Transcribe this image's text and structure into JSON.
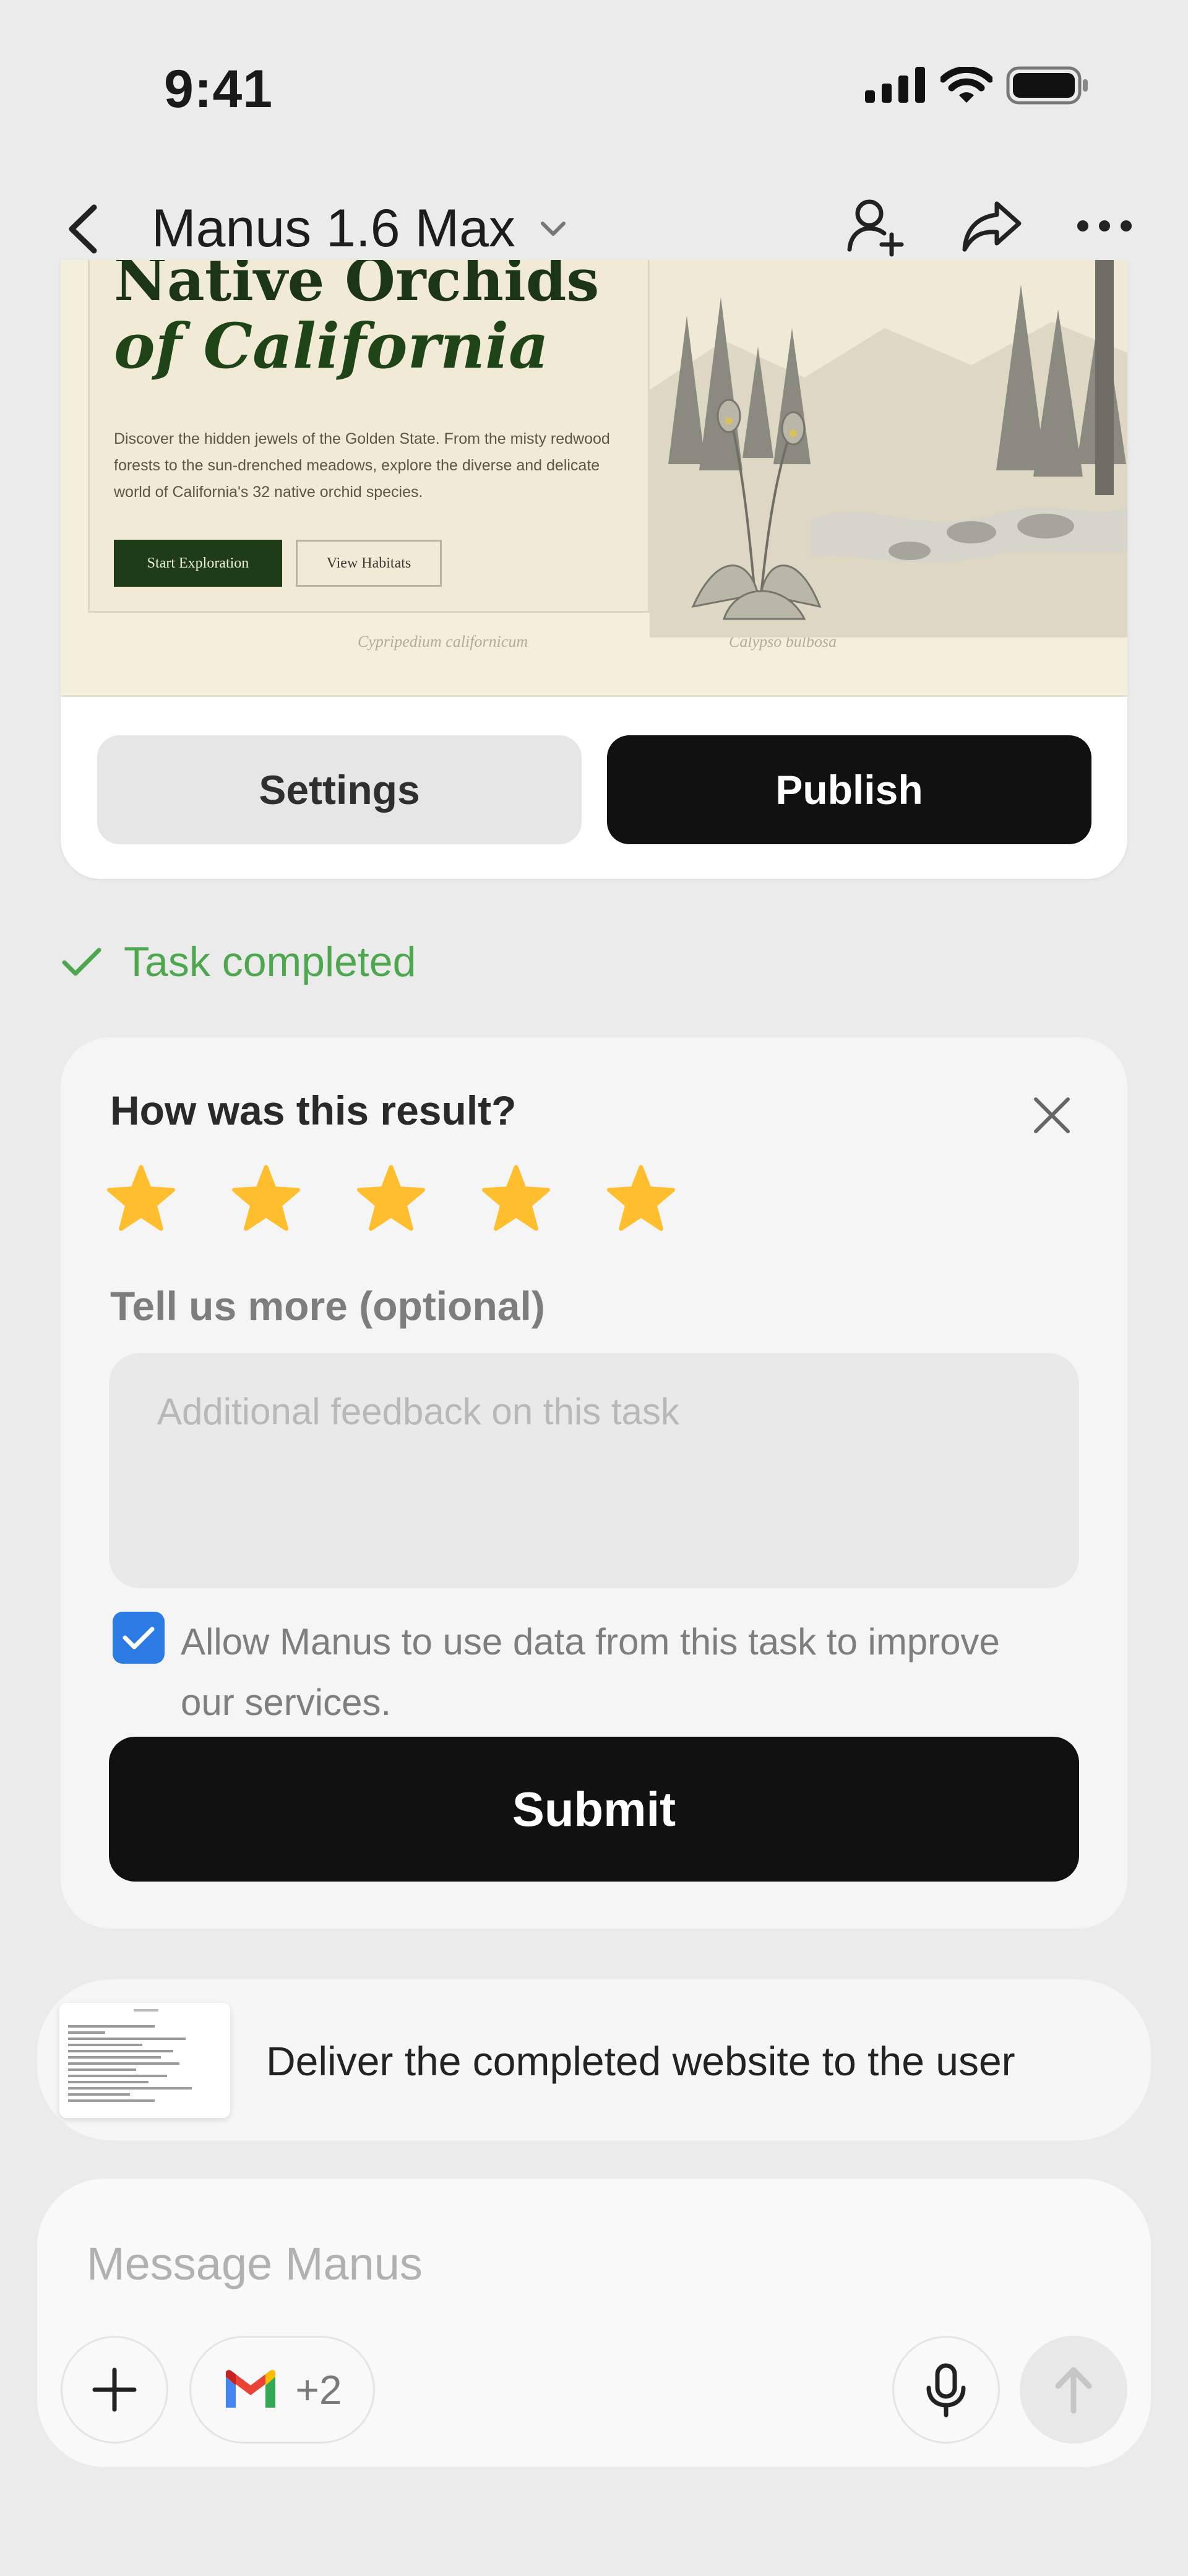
{
  "status_bar": {
    "time": "9:41"
  },
  "header": {
    "title": "Manus 1.6 Max"
  },
  "preview": {
    "hero_title_line1": "Native Orchids",
    "hero_title_line2": "of California",
    "hero_description": "Discover the hidden jewels of the Golden State. From the misty redwood forests to the sun-drenched meadows, explore the diverse and delicate world of California's 32 native orchid species.",
    "primary_button": "Start Exploration",
    "secondary_button": "View Habitats",
    "caption_left": "Cypripedium californicum",
    "caption_right": "Calypso bulbosa"
  },
  "card_actions": {
    "settings_label": "Settings",
    "publish_label": "Publish"
  },
  "task_status": "Task completed",
  "feedback": {
    "title": "How was this result?",
    "rating": 5,
    "rating_max": 5,
    "more_label": "Tell us more (optional)",
    "input_placeholder": "Additional feedback on this task",
    "consent_checked": true,
    "consent_label": "Allow Manus to use data from this task to improve our services.",
    "submit_label": "Submit"
  },
  "step": {
    "text": "Deliver the completed website to the user"
  },
  "composer": {
    "placeholder": "Message Manus",
    "connectors_extra": "+2"
  },
  "colors": {
    "accent_green": "#4ea64e",
    "star": "#ffbe2e",
    "checkbox": "#2c7be5",
    "dark_button": "#111111",
    "hero_green": "#1e3d16"
  }
}
